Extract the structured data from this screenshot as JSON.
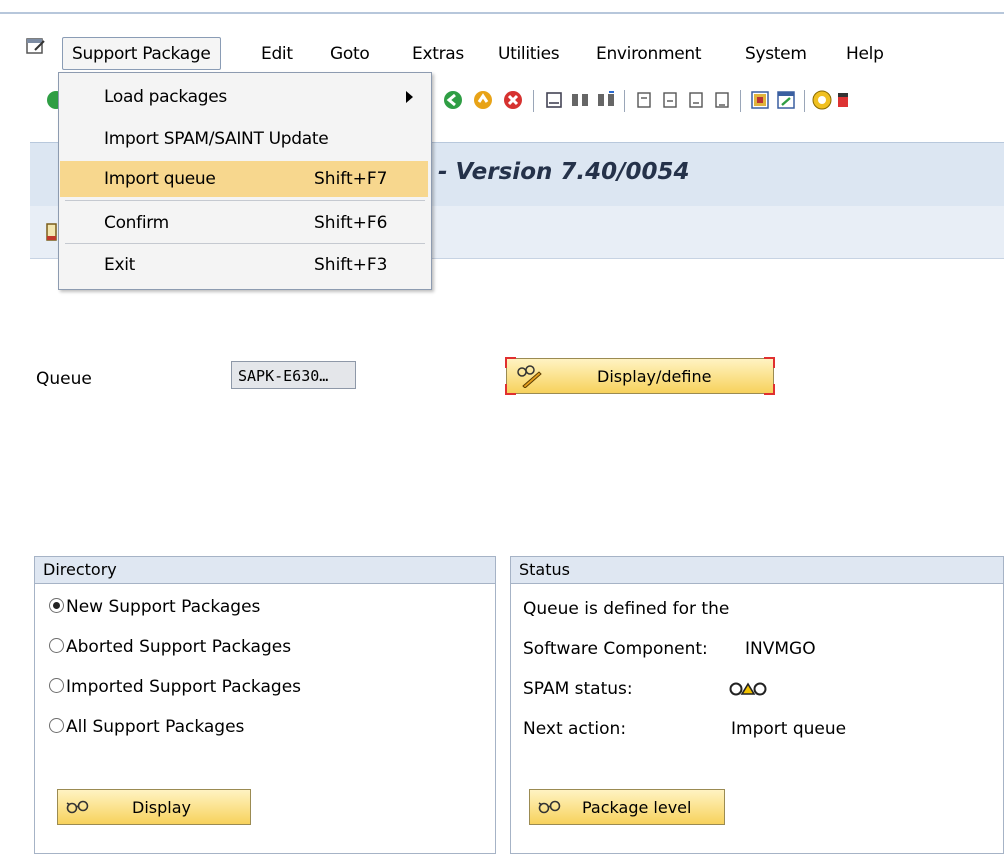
{
  "menubar": {
    "items": [
      "Support Package",
      "Edit",
      "Goto",
      "Extras",
      "Utilities",
      "Environment",
      "System",
      "Help"
    ]
  },
  "toolbar": {
    "icons": [
      "enter-icon",
      "back-icon",
      "exit-icon",
      "cancel-icon",
      "print-icon",
      "find-icon",
      "find-next-icon",
      "first-page-icon",
      "previous-page-icon",
      "next-page-icon",
      "last-page-icon",
      "create-session-icon",
      "shortcut-icon",
      "help-icon",
      "layout-icon"
    ]
  },
  "title": {
    "text": "- Version 7.40/0054"
  },
  "queue": {
    "label": "Queue",
    "value": "SAPK-E630…",
    "button_label": "Display/define"
  },
  "directory": {
    "heading": "Directory",
    "options": [
      "New Support Packages",
      "Aborted Support Packages",
      "Imported Support Packages",
      "All Support Packages"
    ],
    "selected_index": 0,
    "button_label": "Display"
  },
  "status": {
    "heading": "Status",
    "line1": "Queue is defined for the",
    "software_component_label": "Software Component:",
    "software_component_value": "INVMGO",
    "spam_status_label": "SPAM status:",
    "spam_status_icon": "traffic-light-icon",
    "next_action_label": "Next action:",
    "next_action_value": "Import queue",
    "button_label": "Package level"
  },
  "dropdown": {
    "items": [
      {
        "label": "Load packages",
        "shortcut": "",
        "submenu": true
      },
      {
        "label": "Import SPAM/SAINT Update",
        "shortcut": ""
      },
      {
        "label": "Import queue",
        "shortcut": "Shift+F7",
        "highlighted": true
      },
      {
        "label": "Confirm",
        "shortcut": "Shift+F6"
      },
      {
        "label": "Exit",
        "shortcut": "Shift+F3"
      }
    ]
  },
  "colors": {
    "highlight": "#f7d78e",
    "button": "#f7d25c",
    "title_band": "#dce6f2",
    "group_header": "#dfe7f2"
  }
}
